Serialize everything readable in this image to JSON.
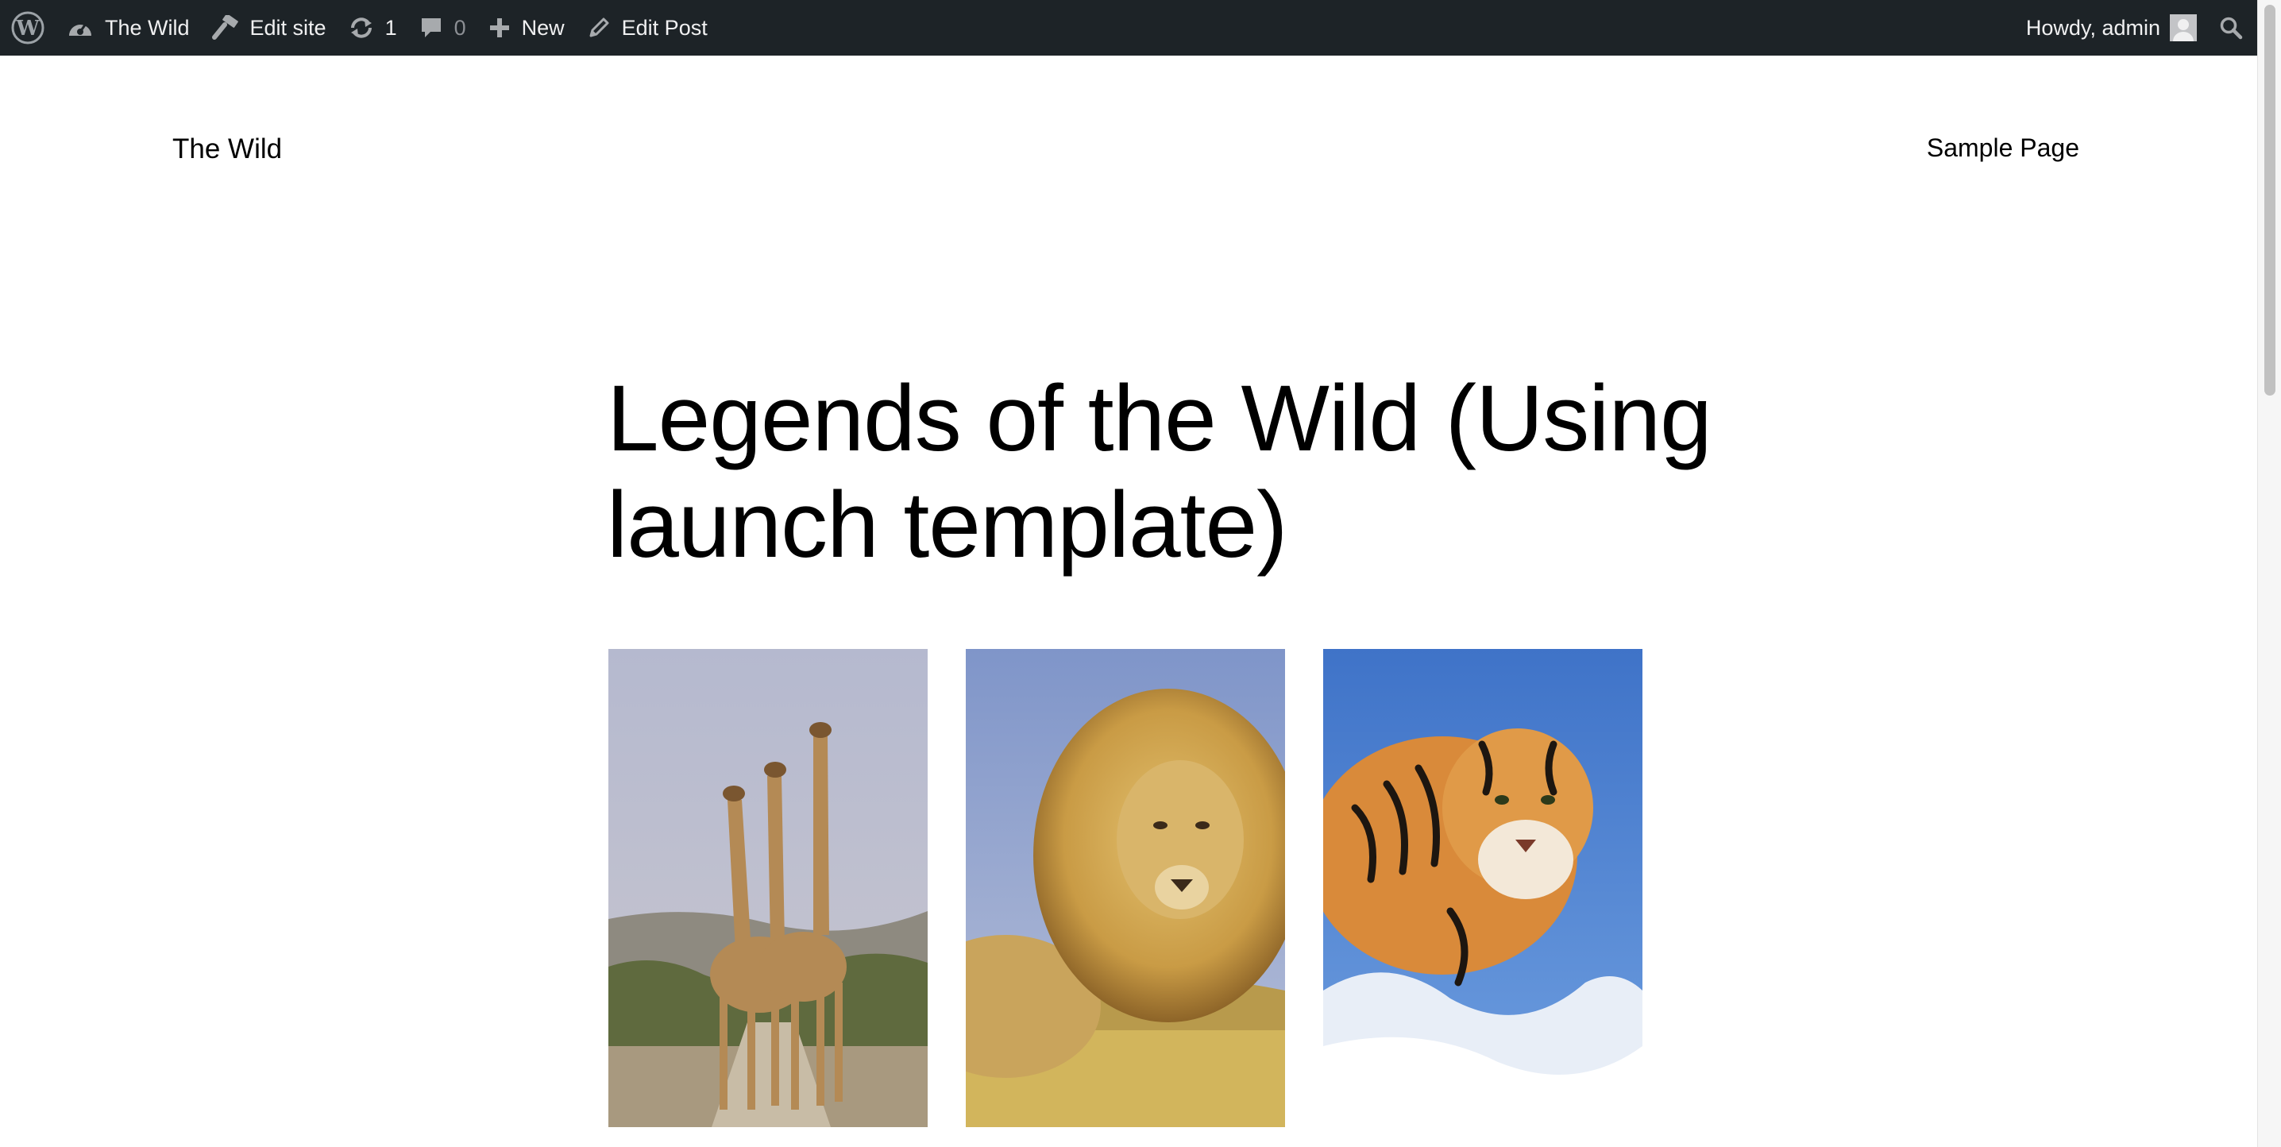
{
  "adminbar": {
    "site_name": "The Wild",
    "edit_site": "Edit site",
    "updates_count": "1",
    "comments_count": "0",
    "new_label": "New",
    "edit_post": "Edit Post",
    "howdy": "Howdy, admin"
  },
  "header": {
    "site_title": "The Wild",
    "nav": [
      "Sample Page"
    ]
  },
  "post": {
    "title": "Legends of the Wild (Using launch template)",
    "gallery": [
      "giraffes",
      "lion",
      "tiger"
    ]
  },
  "colors": {
    "adminbar_bg": "#1d2327",
    "adminbar_text": "#f0f0f1",
    "muted": "#8c8f94"
  }
}
